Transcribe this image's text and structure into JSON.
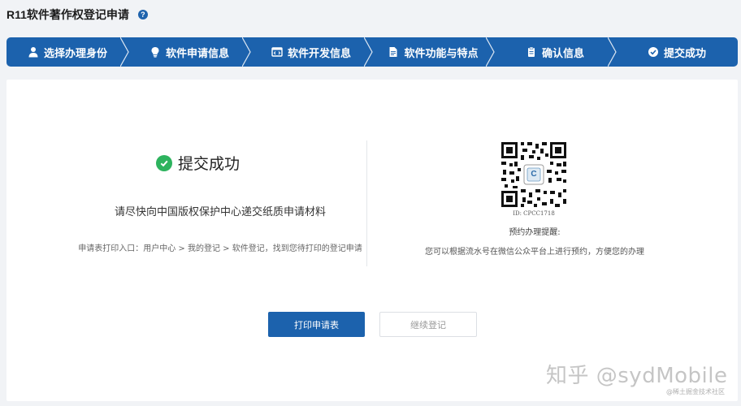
{
  "header": {
    "title": "R11软件著作权登记申请",
    "help_icon": "question-circle-icon"
  },
  "steps": [
    {
      "label": "选择办理身份",
      "icon": "user-icon"
    },
    {
      "label": "软件申请信息",
      "icon": "lightbulb-icon"
    },
    {
      "label": "软件开发信息",
      "icon": "code-window-icon"
    },
    {
      "label": "软件功能与特点",
      "icon": "document-icon"
    },
    {
      "label": "确认信息",
      "icon": "clipboard-icon"
    },
    {
      "label": "提交成功",
      "icon": "check-circle-icon"
    }
  ],
  "result": {
    "title": "提交成功",
    "instruction": "请尽快向中国版权保护中心递交纸质申请材料",
    "print_path": "申请表打印入口：用户中心 > 我的登记 > 软件登记，找到您待打印的登记申请"
  },
  "qr": {
    "logo_letter": "C",
    "id_text": "ID: CPCC1718",
    "reminder_title": "预约办理提醒:",
    "reminder_text": "您可以根据流水号在微信公众平台上进行预约，方便您的办理"
  },
  "buttons": {
    "print": "打印申请表",
    "continue": "继续登记"
  },
  "watermark": {
    "main": "知乎 @sydMobile",
    "sub": "@稀土掘金技术社区"
  },
  "colors": {
    "primary": "#1c62ad",
    "success": "#2db35e"
  }
}
